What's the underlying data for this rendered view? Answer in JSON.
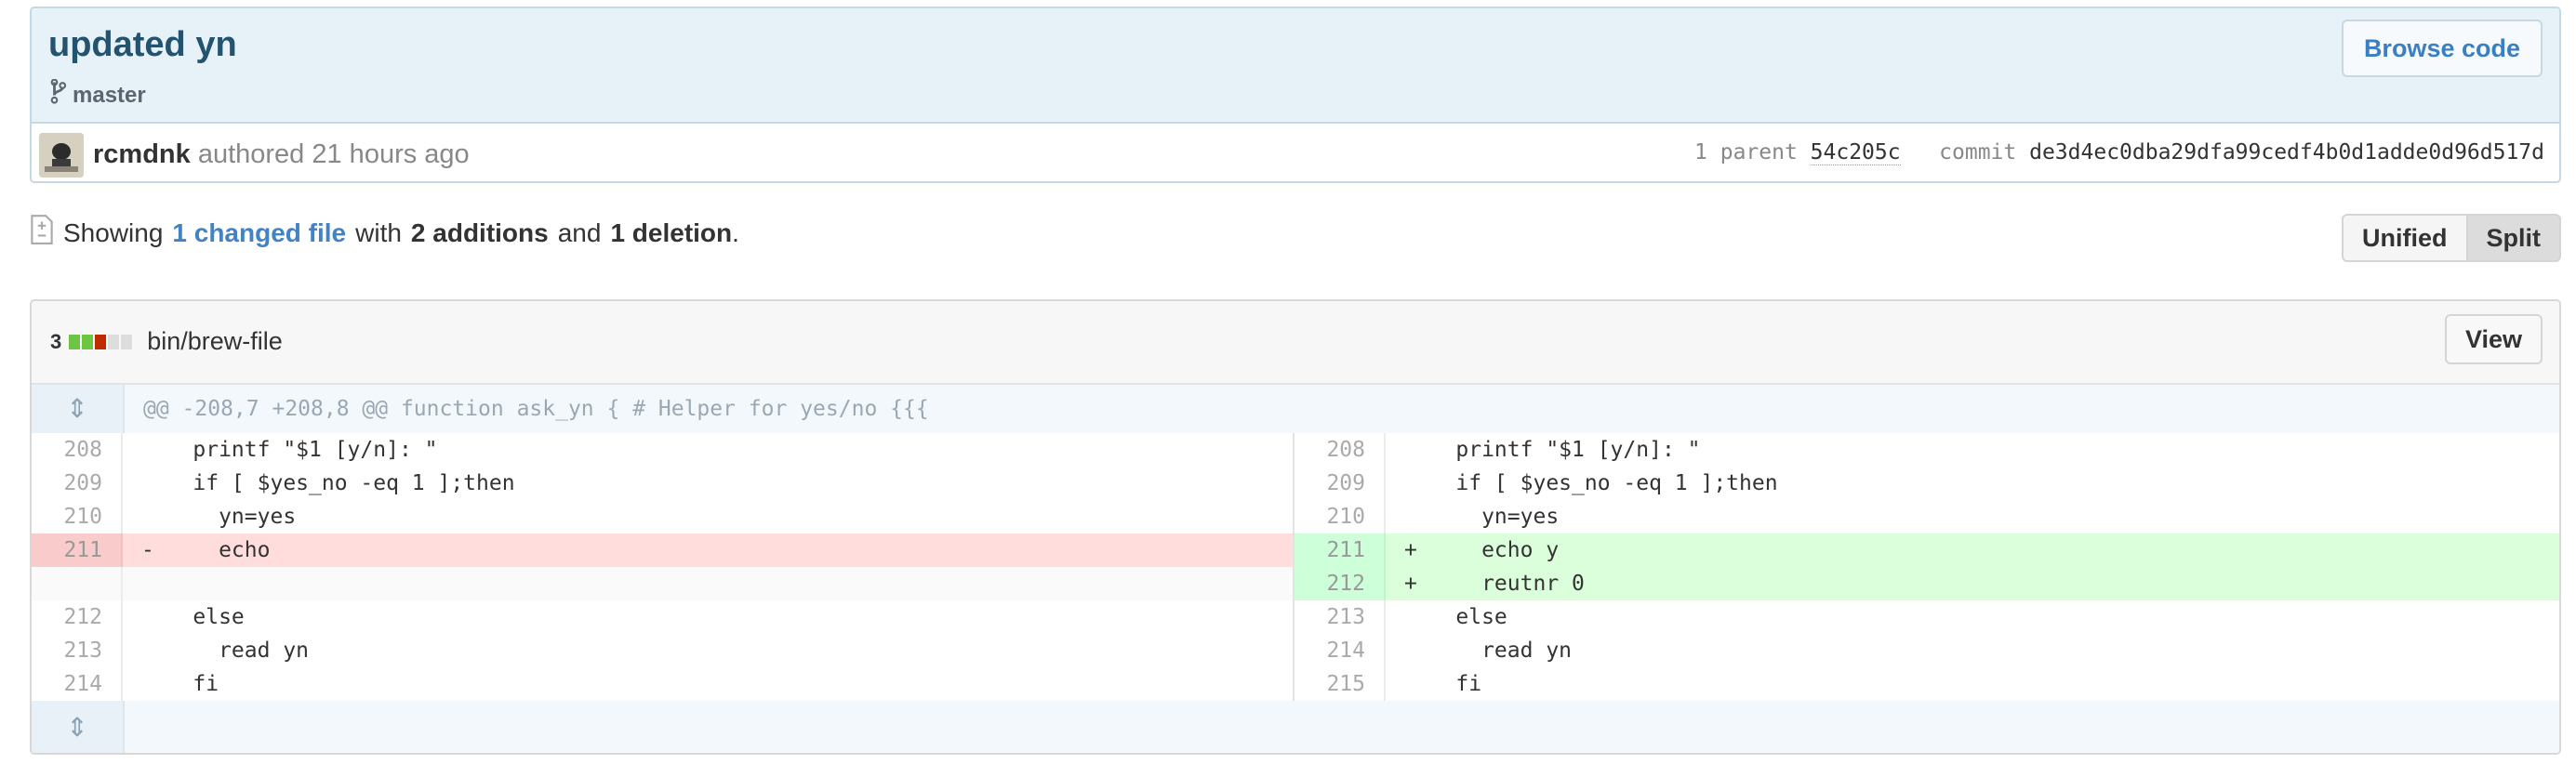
{
  "commit": {
    "title": "updated yn",
    "branch": "master",
    "browse_label": "Browse code",
    "author": "rcmdnk",
    "authored_label": "authored 21 hours ago",
    "parent_label": "1 parent",
    "parent_sha": "54c205c",
    "commit_label": "commit",
    "commit_sha": "de3d4ec0dba29dfa99cedf4b0d1adde0d96d517d"
  },
  "toc": {
    "showing": "Showing",
    "changed_files": "1 changed file",
    "with": "with",
    "additions": "2 additions",
    "and": "and",
    "deletions": "1 deletion",
    "period": ".",
    "unified_label": "Unified",
    "split_label": "Split"
  },
  "file": {
    "changes": "3",
    "name": "bin/brew-file",
    "view_label": "View",
    "diffstat_colors": [
      "#6cc644",
      "#6cc644",
      "#bd2c00",
      "#dddddd",
      "#dddddd"
    ],
    "hunk_header": "@@ -208,7 +208,8 @@ function ask_yn { # Helper for yes/no {{{",
    "left_lines": [
      {
        "num": "208",
        "code": "    printf \"$1 [y/n]: \""
      },
      {
        "num": "209",
        "code": "    if [ $yes_no -eq 1 ];then"
      },
      {
        "num": "210",
        "code": "      yn=yes"
      },
      {
        "num": "211",
        "code": "-     echo",
        "type": "del"
      },
      {
        "num": "",
        "code": "",
        "type": "empty"
      },
      {
        "num": "212",
        "code": "    else"
      },
      {
        "num": "213",
        "code": "      read yn"
      },
      {
        "num": "214",
        "code": "    fi"
      }
    ],
    "right_lines": [
      {
        "num": "208",
        "code": "    printf \"$1 [y/n]: \""
      },
      {
        "num": "209",
        "code": "    if [ $yes_no -eq 1 ];then"
      },
      {
        "num": "210",
        "code": "      yn=yes"
      },
      {
        "num": "211",
        "code": "+     echo y",
        "type": "add"
      },
      {
        "num": "212",
        "code": "+     reutnr 0",
        "type": "add"
      },
      {
        "num": "213",
        "code": "    else"
      },
      {
        "num": "214",
        "code": "      read yn"
      },
      {
        "num": "215",
        "code": "    fi"
      }
    ]
  }
}
